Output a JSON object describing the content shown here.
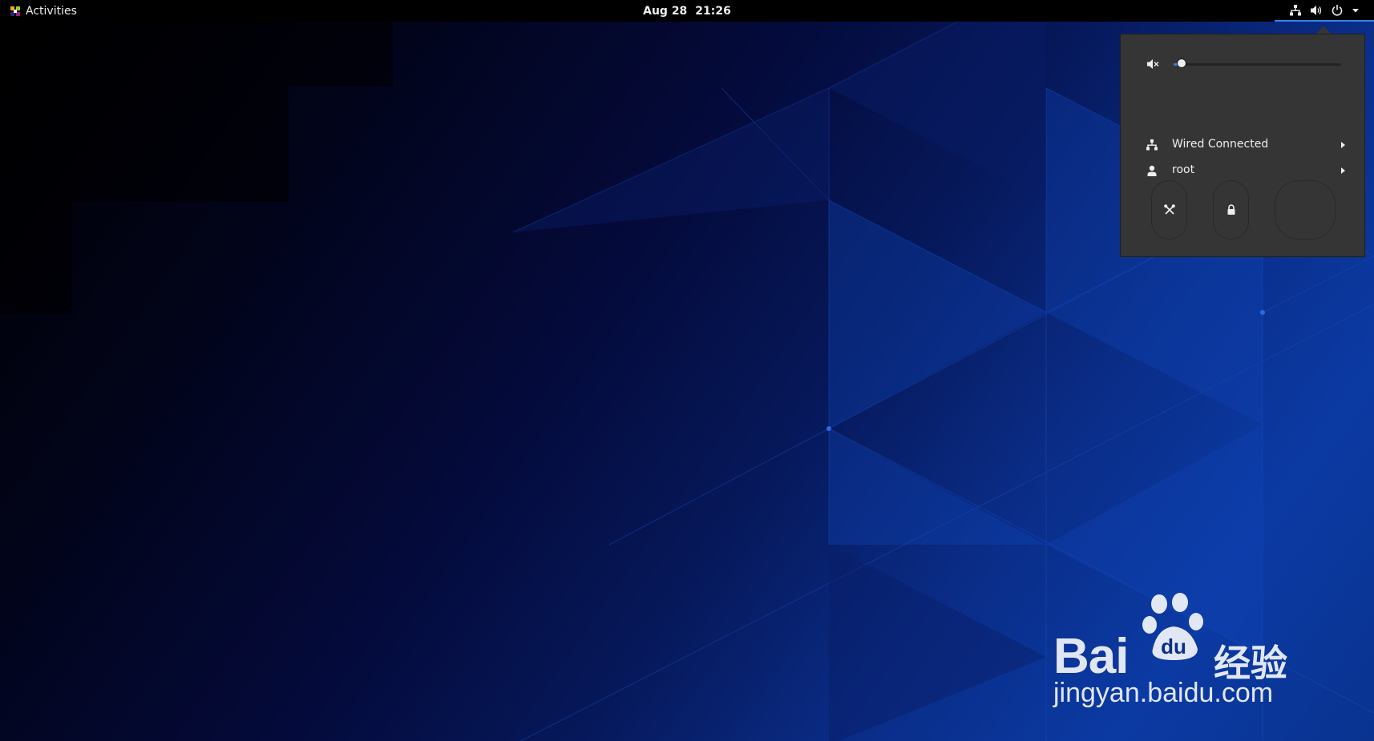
{
  "topbar": {
    "activities_label": "Activities",
    "date": "Aug 28",
    "time": "21:26",
    "status_icons": [
      "network-wired-icon",
      "volume-icon",
      "power-icon",
      "dropdown-arrow-icon"
    ]
  },
  "system_menu": {
    "volume": {
      "icon": "volume-muted-icon",
      "level": 0.05
    },
    "items": [
      {
        "icon": "network-wired-icon",
        "label": "Wired Connected",
        "has_submenu": true
      },
      {
        "icon": "user-icon",
        "label": "root",
        "has_submenu": true
      }
    ],
    "actions": [
      {
        "icon": "settings-icon"
      },
      {
        "icon": "lock-icon"
      },
      {
        "icon": ""
      }
    ]
  },
  "watermark": {
    "brand": "Bai",
    "brand_paw_text": "du",
    "cn_text": "经验",
    "site": "jingyan.baidu.com"
  },
  "colors": {
    "accent": "#3584e4",
    "topbar_bg": "#000000",
    "menu_bg": "#353535",
    "wallpaper_blue": "#0b3aa3"
  }
}
